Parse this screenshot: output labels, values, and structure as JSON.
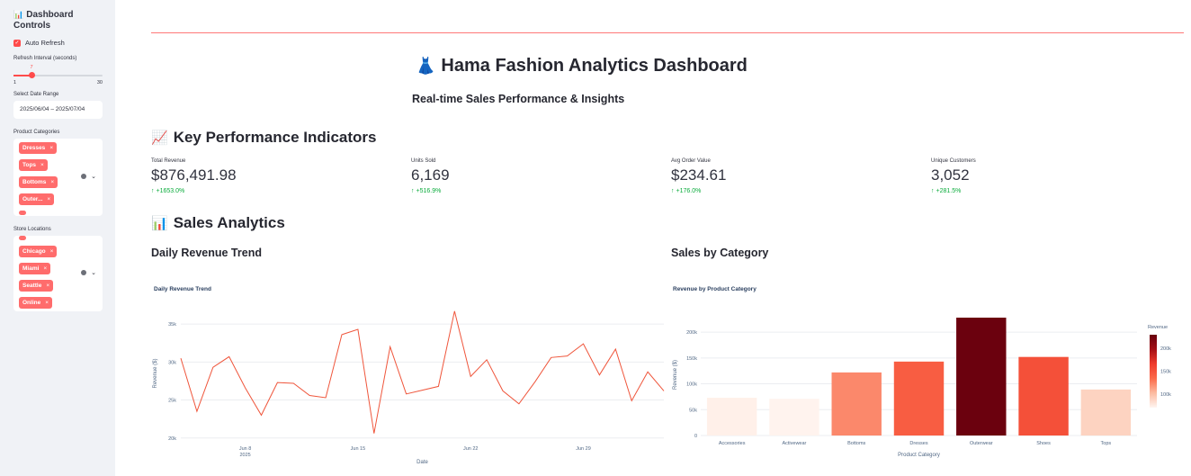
{
  "sidebar": {
    "title_icon": "bar-chart-icon",
    "title": "Dashboard Controls",
    "auto_refresh_label": "Auto Refresh",
    "auto_refresh_checked": true,
    "refresh_label": "Refresh Interval (seconds)",
    "refresh_value": "7",
    "refresh_min": "1",
    "refresh_max": "30",
    "date_label": "Select Date Range",
    "date_value": "2025/06/04 – 2025/07/04",
    "categories_label": "Product Categories",
    "categories": [
      "Dresses",
      "Tops",
      "Bottoms",
      "Outer..."
    ],
    "locations_label": "Store Locations",
    "locations": [
      "Chicago",
      "Miami",
      "Seattle",
      "Online"
    ],
    "tag_close": "×"
  },
  "header": {
    "icon": "dress-icon",
    "title": "Hama Fashion Analytics Dashboard",
    "subtitle": "Real-time Sales Performance & Insights"
  },
  "kpi_section": {
    "icon": "trend-chart-icon",
    "title": "Key Performance Indicators",
    "metrics": [
      {
        "label": "Total Revenue",
        "value": "$876,491.98",
        "delta": "+1653.0%"
      },
      {
        "label": "Units Sold",
        "value": "6,169",
        "delta": "+516.9%"
      },
      {
        "label": "Avg Order Value",
        "value": "$234.61",
        "delta": "+176.0%"
      },
      {
        "label": "Unique Customers",
        "value": "3,052",
        "delta": "+281.5%"
      }
    ],
    "delta_color": "#09ab3b"
  },
  "sales_section": {
    "icon": "bar-chart-icon",
    "title": "Sales Analytics",
    "left_subtitle": "Daily Revenue Trend",
    "right_subtitle": "Sales by Category"
  },
  "colors": {
    "accent": "#ff4b4b",
    "tag": "#ff6c6c",
    "line": "#ef553b"
  },
  "chart_data": [
    {
      "type": "line",
      "title": "Daily Revenue Trend",
      "xlabel": "Date",
      "ylabel": "Revenue ($)",
      "x": [
        "2025-06-04",
        "2025-06-05",
        "2025-06-06",
        "2025-06-07",
        "2025-06-08",
        "2025-06-09",
        "2025-06-10",
        "2025-06-11",
        "2025-06-12",
        "2025-06-13",
        "2025-06-14",
        "2025-06-15",
        "2025-06-16",
        "2025-06-17",
        "2025-06-18",
        "2025-06-19",
        "2025-06-20",
        "2025-06-21",
        "2025-06-22",
        "2025-06-23",
        "2025-06-24",
        "2025-06-25",
        "2025-06-26",
        "2025-06-27",
        "2025-06-28",
        "2025-06-29",
        "2025-06-30",
        "2025-07-01",
        "2025-07-02",
        "2025-07-03",
        "2025-07-04"
      ],
      "series": [
        {
          "values": [
            30500,
            23500,
            29300,
            30700,
            26600,
            23000,
            27300,
            27200,
            25600,
            25300,
            33600,
            34300,
            20600,
            32000,
            25800,
            26300,
            26800,
            36700,
            28100,
            30300,
            26200,
            24500,
            27400,
            30600,
            30800,
            32400,
            28300,
            31700,
            24900,
            28700,
            26200
          ]
        }
      ],
      "x_ticks": [
        "Jun 8\n2025",
        "Jun 15",
        "Jun 22",
        "Jun 29"
      ],
      "y_ticks": [
        "20k",
        "25k",
        "30k",
        "35k"
      ],
      "ylim": [
        19500,
        37500
      ],
      "grid": true
    },
    {
      "type": "bar",
      "title": "Revenue by Product Category",
      "xlabel": "Product Category",
      "ylabel": "Revenue ($)",
      "categories": [
        "Accessories",
        "Activewear",
        "Bottoms",
        "Dresses",
        "Outerwear",
        "Shoes",
        "Tops"
      ],
      "values": [
        73000,
        71000,
        122000,
        143000,
        228000,
        152000,
        89000
      ],
      "y_ticks": [
        "0",
        "50k",
        "100k",
        "150k",
        "200k"
      ],
      "ylim": [
        0,
        235000
      ],
      "colorbar": {
        "title": "Revenue",
        "ticks": [
          "100k",
          "150k",
          "200k"
        ],
        "range": [
          70000,
          230000
        ]
      },
      "grid": true
    }
  ]
}
